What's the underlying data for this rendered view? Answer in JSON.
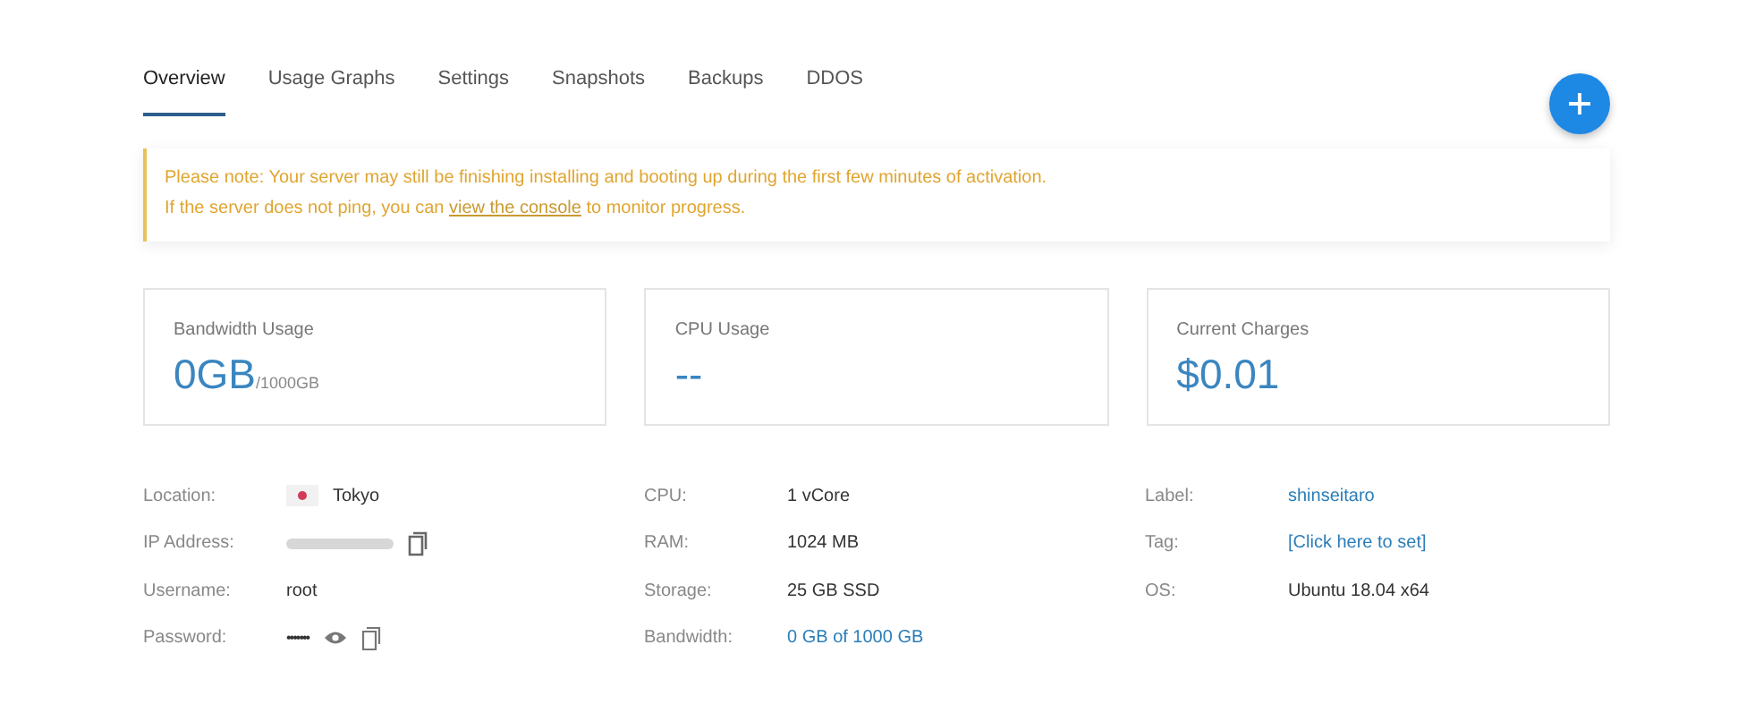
{
  "tabs": [
    {
      "label": "Overview",
      "selected": true
    },
    {
      "label": "Usage Graphs",
      "selected": false
    },
    {
      "label": "Settings",
      "selected": false
    },
    {
      "label": "Snapshots",
      "selected": false
    },
    {
      "label": "Backups",
      "selected": false
    },
    {
      "label": "DDOS",
      "selected": false
    }
  ],
  "notice": {
    "line1": "Please note: Your server may still be finishing installing and booting up during the first few minutes of activation.",
    "line2_before": "If the server does not ping, you can",
    "link": "view the console",
    "line2_after": "to monitor progress."
  },
  "cards": [
    {
      "title": "Bandwidth Usage",
      "value": "0GB",
      "unit": "/1000GB"
    },
    {
      "title": "CPU Usage",
      "value": "--"
    },
    {
      "title": "Current Charges",
      "value": "$0.01"
    }
  ],
  "columns": [
    [
      {
        "label": "Location:",
        "value": "Tokyo",
        "kind": "flag"
      },
      {
        "label": "IP Address:",
        "kind": "redacted"
      },
      {
        "label": "Username:",
        "value": "root",
        "kind": "plain"
      },
      {
        "label": "Password:",
        "value": "•••••••",
        "kind": "password"
      }
    ],
    [
      {
        "label": "CPU:",
        "value": "1 vCore",
        "kind": "plain"
      },
      {
        "label": "RAM:",
        "value": "1024 MB",
        "kind": "plain"
      },
      {
        "label": "Storage:",
        "value": "25 GB SSD",
        "kind": "plain"
      },
      {
        "label": "Bandwidth:",
        "value": "0 GB of 1000 GB",
        "kind": "link"
      }
    ],
    [
      {
        "label": "Label:",
        "value": "shinseitaro",
        "kind": "link"
      },
      {
        "label": "Tag:",
        "value": "[Click here to set]",
        "kind": "link"
      },
      {
        "label": "OS:",
        "value": "Ubuntu 18.04 x64",
        "kind": "plain"
      }
    ]
  ]
}
